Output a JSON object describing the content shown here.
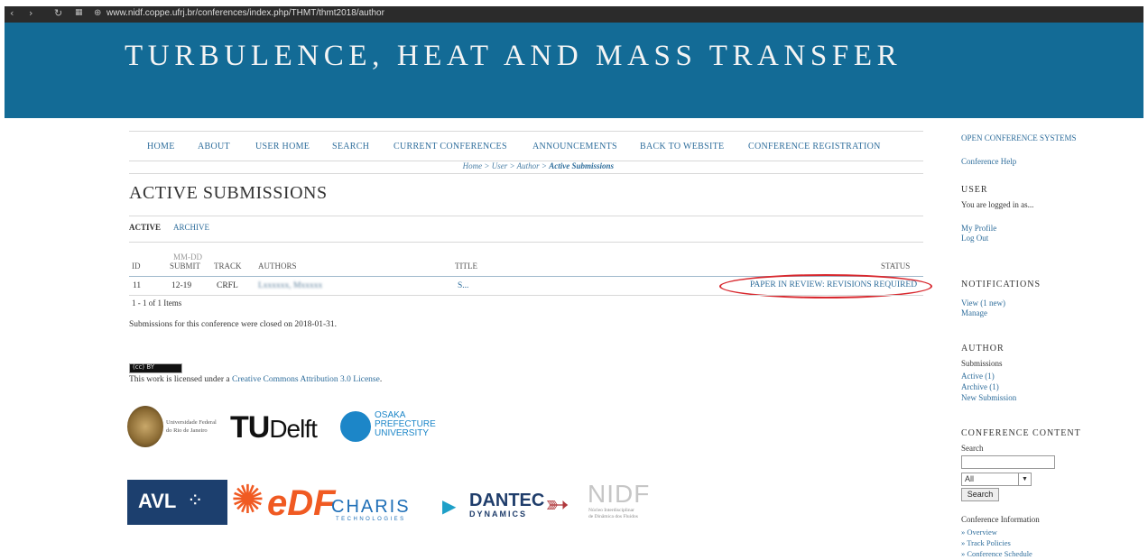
{
  "browser": {
    "back_icon": "chevron-left-icon",
    "forward_icon": "chevron-right-icon",
    "reload_icon": "reload-icon",
    "apps_icon": "apps-grid-icon",
    "site_icon": "globe-icon",
    "url": "www.nidf.coppe.ufrj.br/conferences/index.php/THMT/thmt2018/author"
  },
  "header": {
    "title": "TURBULENCE, HEAT AND MASS TRANSFER",
    "bg_color": "#136b96"
  },
  "nav": {
    "items": [
      "HOME",
      "ABOUT",
      "USER HOME",
      "SEARCH",
      "CURRENT CONFERENCES",
      "ANNOUNCEMENTS",
      "BACK TO WEBSITE",
      "CONFERENCE REGISTRATION"
    ]
  },
  "breadcrumb": {
    "home": "Home",
    "sep": " > ",
    "user": "User",
    "author": "Author",
    "current": "Active Submissions"
  },
  "page": {
    "title": "ACTIVE SUBMISSIONS"
  },
  "tabs": {
    "active": "ACTIVE",
    "archive": "ARCHIVE"
  },
  "table": {
    "headers": {
      "id": "ID",
      "mmdd": "MM-DD",
      "submit": "SUBMIT",
      "track": "TRACK",
      "authors": "AUTHORS",
      "title": "TITLE",
      "status": "STATUS"
    },
    "rows": [
      {
        "id": "11",
        "date": "12-19",
        "track": "CRFL",
        "authors": "Lxxxxxx, Mxxxxx",
        "title": "S...",
        "status": "PAPER IN REVIEW: REVISIONS REQUIRED"
      }
    ],
    "count": "1 - 1 of 1 Items"
  },
  "closed_message": "Submissions for this conference were closed on 2018-01-31.",
  "license": {
    "badge": "(cc) BY",
    "prefix": "This work is licensed under a ",
    "link": "Creative Commons Attribution 3.0 License",
    "suffix": "."
  },
  "logos": {
    "ufrj": {
      "line1": "Universidade Federal",
      "line2": "do Rio de Janeiro"
    },
    "tudelft": {
      "tu": "TU",
      "delft": "Delft"
    },
    "osaka": {
      "line1": "Osaka",
      "line2": "Prefecture",
      "line3": "University"
    },
    "avl": "AVL",
    "edf": "eDF",
    "charis": {
      "name": "CHARIS",
      "sub": "TECHNOLOGIES"
    },
    "dantec": {
      "line1": "DANTEC",
      "line2": "DYNAMICS"
    },
    "nidf": {
      "name": "NIDF",
      "sub1": "Núcleo Interdisciplinar",
      "sub2": "de Dinâmica dos Fluidos"
    }
  },
  "sidebar": {
    "ocs": "OPEN CONFERENCE SYSTEMS",
    "help": "Conference Help",
    "user_heading": "USER",
    "logged_in": "You are logged in as...",
    "my_profile": "My Profile",
    "log_out": "Log Out",
    "notifications_heading": "NOTIFICATIONS",
    "view": "View (1 new)",
    "manage": "Manage",
    "author_heading": "AUTHOR",
    "submissions": "Submissions",
    "active": "Active (1)",
    "archive": "Archive (1)",
    "new_submission": "New Submission",
    "content_heading": "CONFERENCE CONTENT",
    "search_label": "Search",
    "select_value": "All",
    "search_button": "Search",
    "info_label": "Conference Information",
    "overview": "» Overview",
    "track_policies": "» Track Policies",
    "schedule": "» Conference Schedule"
  },
  "annotation_color": "#d8282e"
}
